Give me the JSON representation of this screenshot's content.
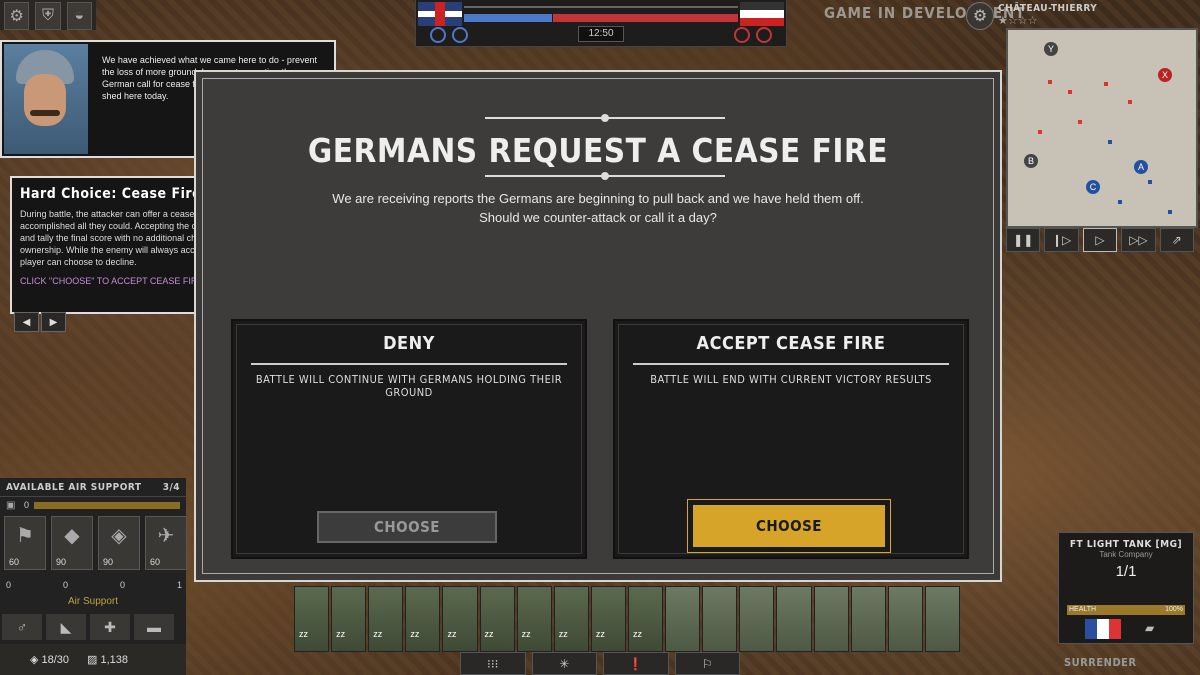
{
  "top": {
    "timer": "12:50",
    "status": "GAME IN DEVELOPMENT"
  },
  "minimap": {
    "title": "CHÂTEAU-THIERRY",
    "stars": "★☆☆☆",
    "markers": [
      "Y",
      "X",
      "B",
      "A",
      "C"
    ]
  },
  "advisor": {
    "message": "We have achieved what we came here to do - prevent the loss of more ground. I suggest accepting the German call for cease fire - enough blood has been shed here today."
  },
  "hard_choice": {
    "title": "Hard Choice: Cease Fire",
    "body": "During battle, the attacker can offer a cease fire when they feel they have accomplished all they could. Accepting the cease fire will end the battle and tally the final score with no additional change to control point ownership. While the enemy will always accept a player Cease Fire, the player can choose to decline.",
    "hint": "CLICK \"CHOOSE\" TO ACCEPT CEASE FIRE"
  },
  "modal": {
    "title": "GERMANS REQUEST A CEASE FIRE",
    "desc_line1": "We are receiving reports the Germans are beginning to pull back and we have held them off.",
    "desc_line2": "Should we counter-attack or call it a day?",
    "deny": {
      "title": "DENY",
      "desc": "BATTLE WILL CONTINUE WITH GERMANS HOLDING THEIR GROUND",
      "button": "CHOOSE"
    },
    "accept": {
      "title": "ACCEPT CEASE FIRE",
      "desc": "BATTLE WILL END WITH CURRENT VICTORY RESULTS",
      "button": "CHOOSE"
    }
  },
  "air_support": {
    "title": "AVAILABLE AIR SUPPORT",
    "count": "3/4",
    "points": "0",
    "cards": [
      {
        "icon": "flag-icon",
        "cost": "60"
      },
      {
        "icon": "bomb-icon",
        "cost": "90"
      },
      {
        "icon": "bombs-icon",
        "cost": "90"
      },
      {
        "icon": "plane-icon",
        "cost": "60"
      }
    ],
    "zeros": [
      "0",
      "0",
      "0",
      "1"
    ],
    "label": "Air Support",
    "resource_1": "18/30",
    "resource_2": "1,138"
  },
  "unit_panel": {
    "name": "FT LIGHT TANK [MG]",
    "company": "Tank Company",
    "count": "1/1",
    "health_label": "HEALTH",
    "health_value": "100%"
  },
  "surrender": "SURRENDER",
  "colors": {
    "accent": "#d6a428",
    "allied": "#4c78c8",
    "enemy": "#c0353a"
  }
}
